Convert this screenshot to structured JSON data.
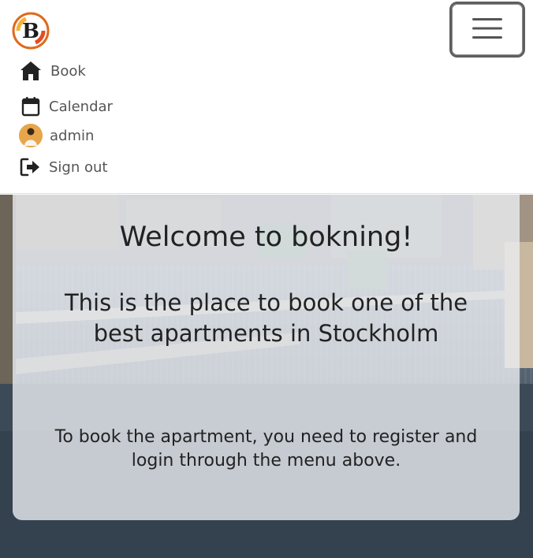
{
  "brand": {
    "logo_letter": "B",
    "accent": "#f08a1a"
  },
  "nav": {
    "toggle_icon": "hamburger-icon",
    "items": [
      {
        "label": "Book",
        "icon": "home-icon"
      },
      {
        "label": "Calendar",
        "icon": "calendar-icon"
      },
      {
        "label": "admin",
        "icon": "avatar"
      },
      {
        "label": "Sign out",
        "icon": "sign-out-icon"
      }
    ]
  },
  "hero": {
    "title": "Welcome to bokning!",
    "subtitle": "This is the place to book one of the best apartments in Stockholm",
    "info": "To book the apartment, you need to register and login through the menu above."
  }
}
